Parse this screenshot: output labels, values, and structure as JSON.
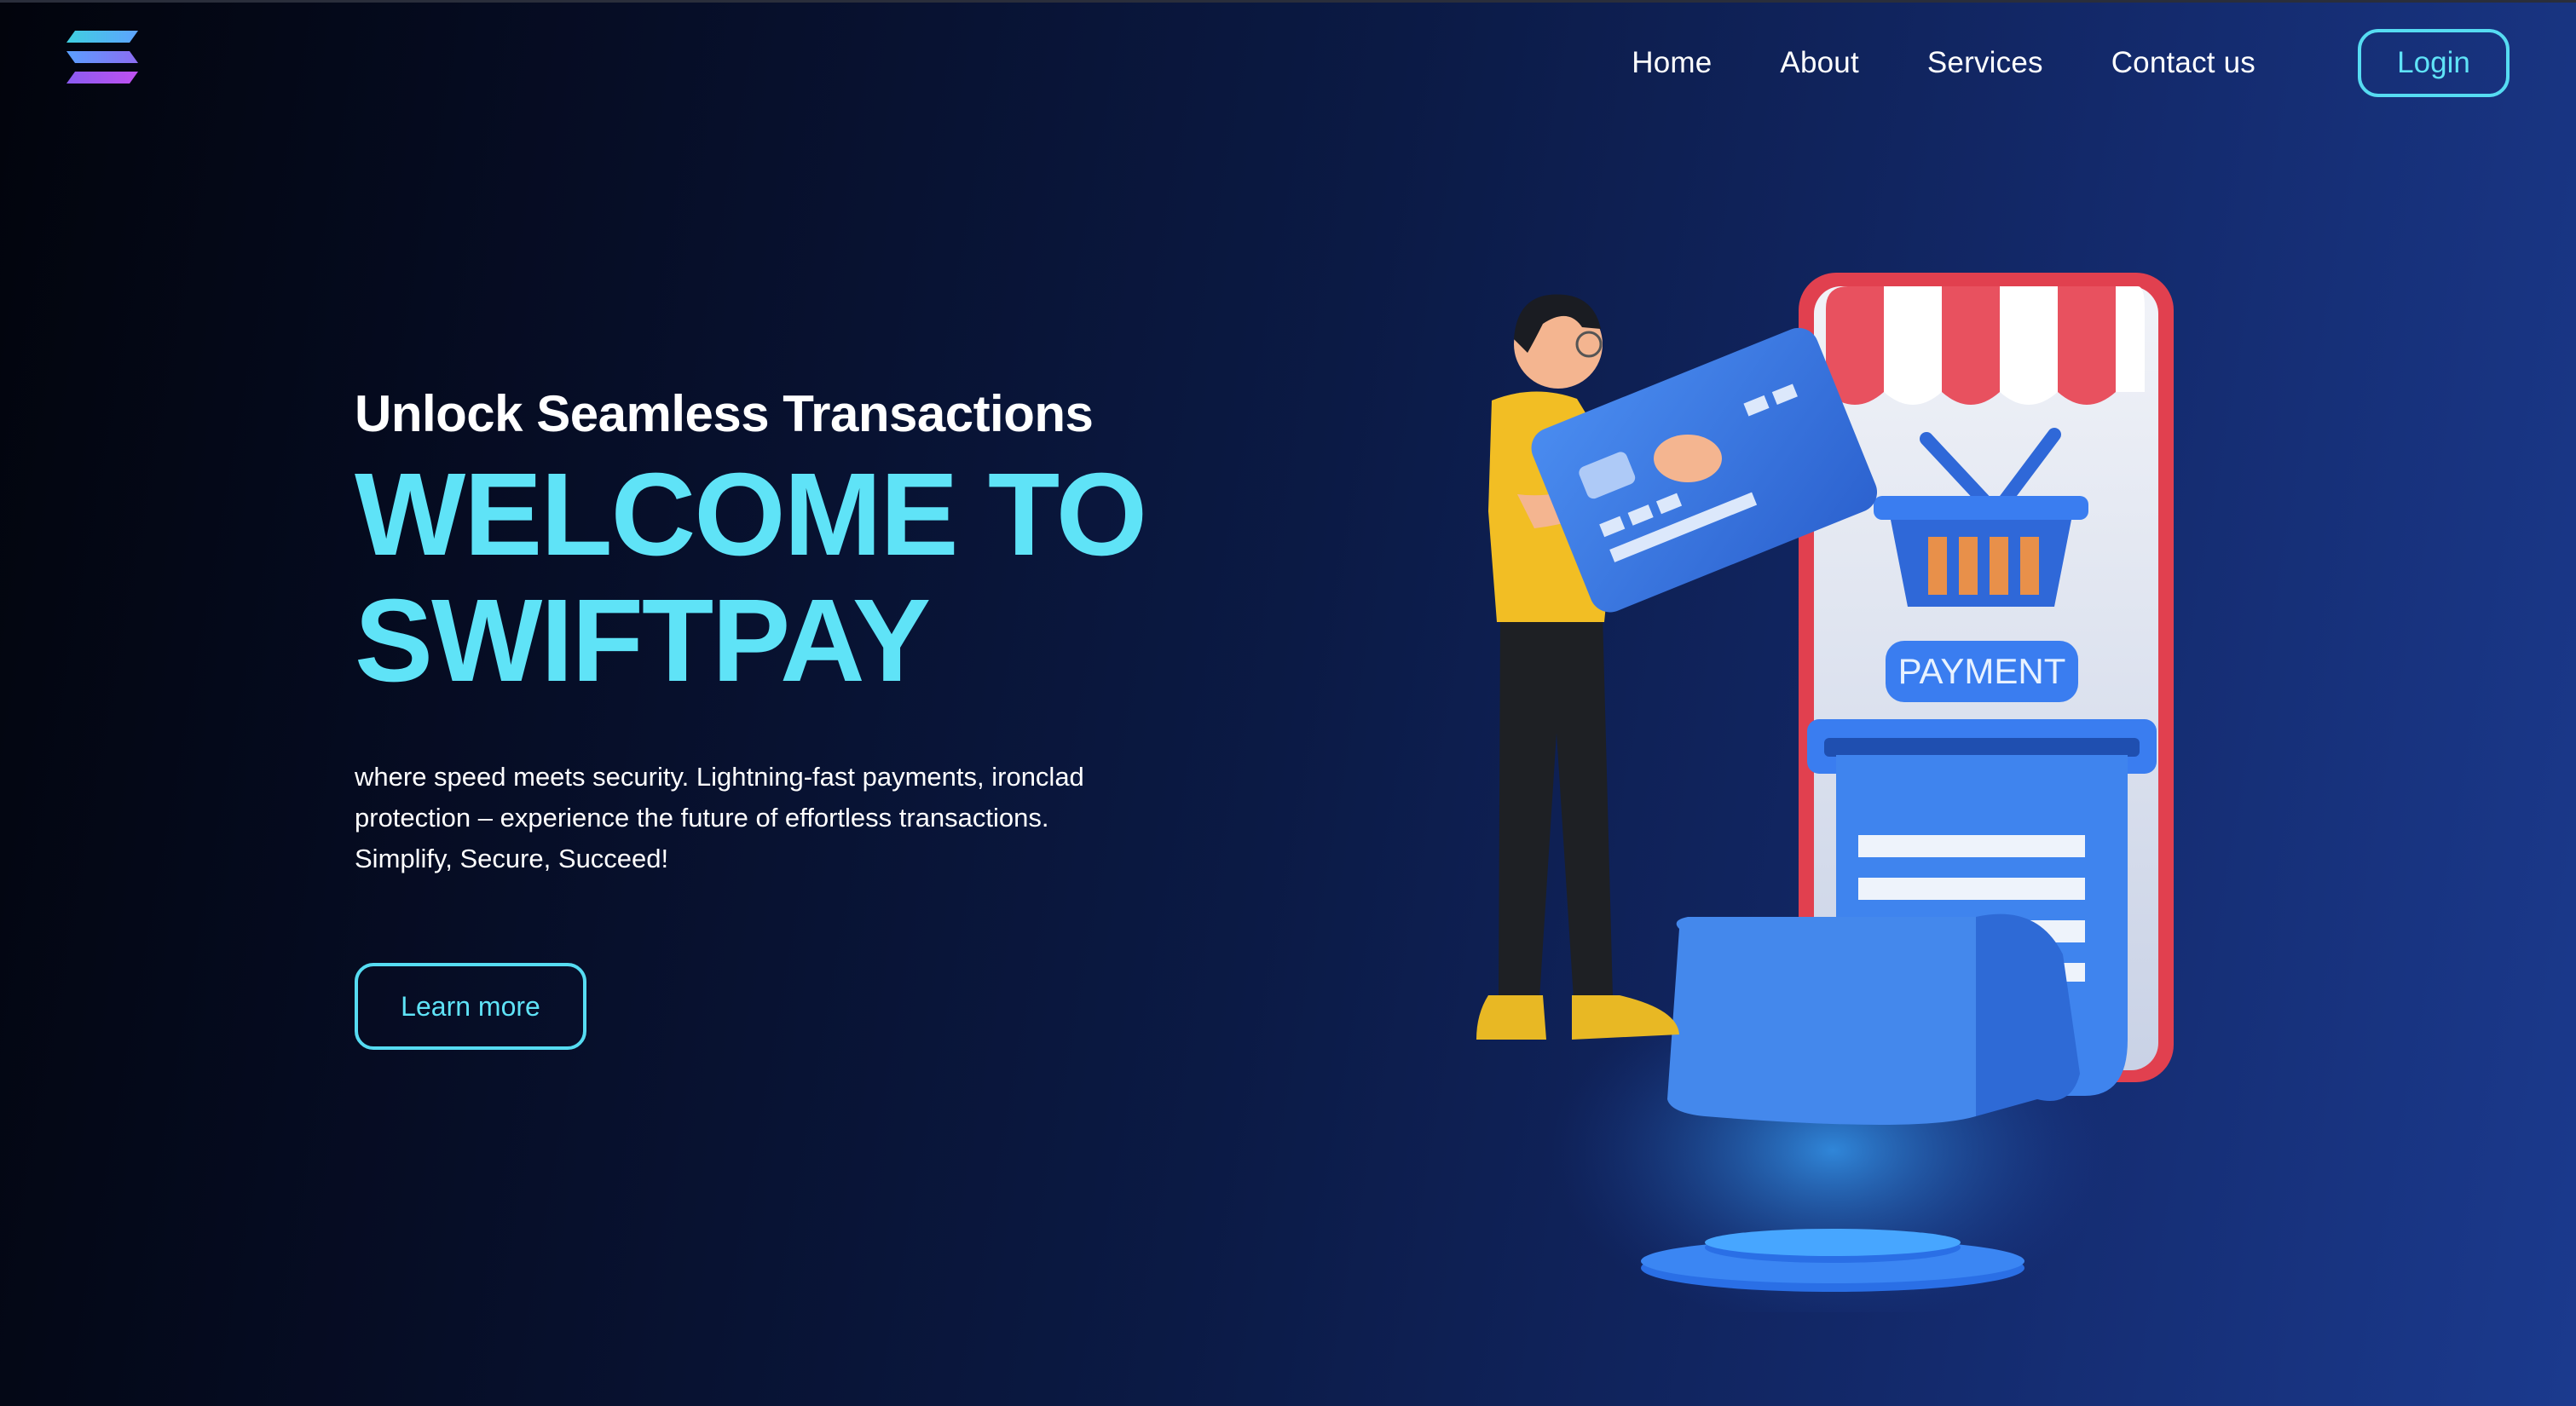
{
  "brand": {
    "logo_icon": "stacked-bars-logo-icon",
    "colors": {
      "accent": "#5fe3f7",
      "text": "#ffffff",
      "bg_dark": "#02040c",
      "bg_blue": "#1b3a8e"
    }
  },
  "nav": {
    "items": [
      {
        "label": "Home"
      },
      {
        "label": "About"
      },
      {
        "label": "Services"
      },
      {
        "label": "Contact us"
      }
    ],
    "login_label": "Login"
  },
  "hero": {
    "kicker": "Unlock Seamless Transactions",
    "headline_line1": "WELCOME TO",
    "headline_line2": "SWIFTPAY",
    "lead_line1": "where speed meets security. Lightning-fast payments, ironclad",
    "lead_line2": "protection – experience the future of effortless transactions.",
    "lead_line3": "Simplify, Secure, Succeed!",
    "cta_label": "Learn more"
  },
  "illustration": {
    "description_icon": "payment-illustration-icon",
    "payment_label": "PAYMENT"
  }
}
